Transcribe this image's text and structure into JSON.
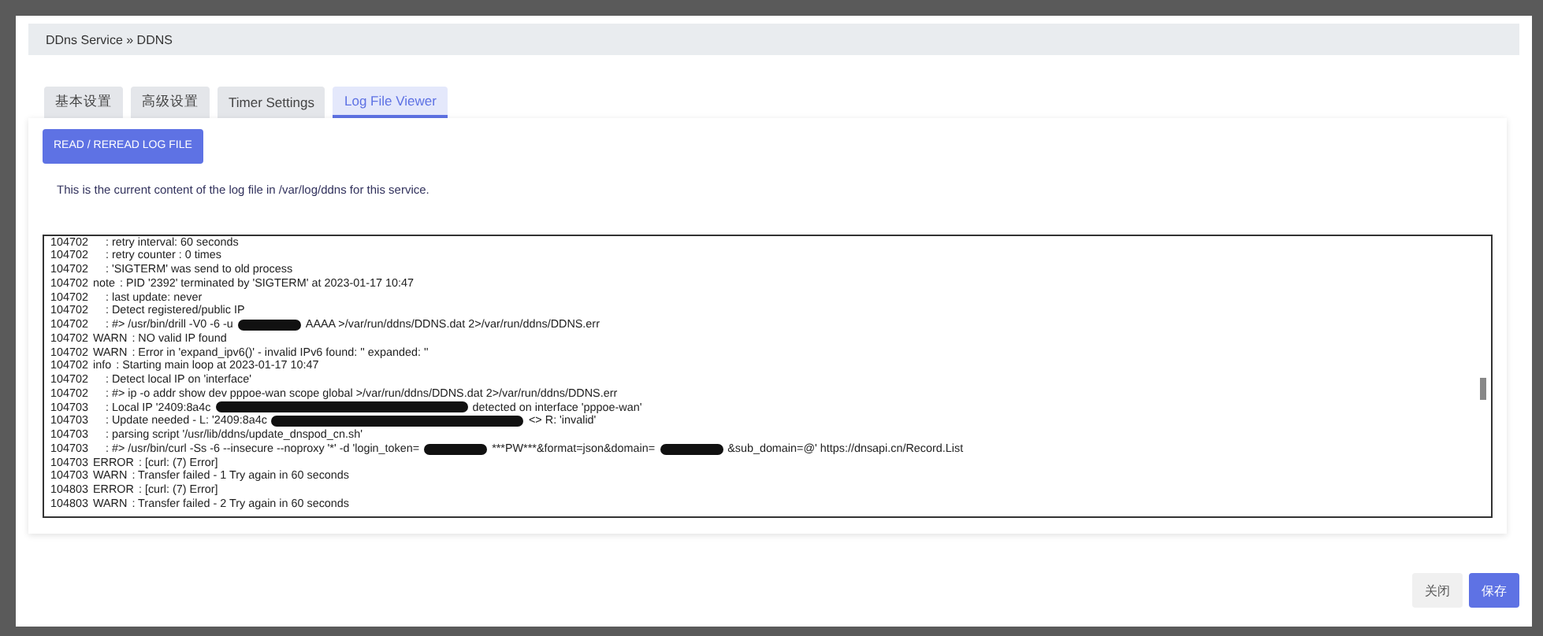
{
  "breadcrumb": "DDns Service » DDNS",
  "tabs": [
    {
      "label": "基本设置",
      "selected": false
    },
    {
      "label": "高级设置",
      "selected": false
    },
    {
      "label": "Timer Settings",
      "selected": false
    },
    {
      "label": "Log File Viewer",
      "selected": true
    }
  ],
  "read_button": "READ / REREAD LOG FILE",
  "description": "This is the current content of the log file in /var/log/ddns for this service.",
  "log_lines": [
    {
      "time": "104702",
      "parts": [
        {
          "kind": "text",
          "text": ": retry interval: 60 seconds"
        }
      ]
    },
    {
      "time": "104702",
      "parts": [
        {
          "kind": "text",
          "text": ": retry counter : 0 times"
        }
      ]
    },
    {
      "time": "104702",
      "parts": [
        {
          "kind": "text",
          "text": ": 'SIGTERM' was send to old process"
        }
      ]
    },
    {
      "time": "104702",
      "level": "note",
      "parts": [
        {
          "kind": "text",
          "text": ": PID '2392' terminated by 'SIGTERM' at 2023-01-17 10:47"
        }
      ]
    },
    {
      "time": "104702",
      "parts": [
        {
          "kind": "text",
          "text": ": last update: never"
        }
      ]
    },
    {
      "time": "104702",
      "parts": [
        {
          "kind": "text",
          "text": ": Detect registered/public IP"
        }
      ]
    },
    {
      "time": "104702",
      "parts": [
        {
          "kind": "text",
          "text": ": #> /usr/bin/drill -V0 -6 -u"
        },
        {
          "kind": "redaction"
        },
        {
          "kind": "text",
          "text": "AAAA >/var/run/ddns/DDNS.dat 2>/var/run/ddns/DDNS.err"
        }
      ]
    },
    {
      "time": "104702",
      "level": "WARN",
      "parts": [
        {
          "kind": "text",
          "text": ": NO valid IP found"
        }
      ]
    },
    {
      "time": "104702",
      "level": "WARN",
      "parts": [
        {
          "kind": "text",
          "text": ": Error in 'expand_ipv6()' - invalid IPv6 found: '' expanded: ''"
        }
      ]
    },
    {
      "time": "104702",
      "level": "info",
      "parts": [
        {
          "kind": "text",
          "text": ": Starting main loop at 2023-01-17 10:47"
        }
      ]
    },
    {
      "time": "104702",
      "parts": [
        {
          "kind": "text",
          "text": ": Detect local IP on 'interface'"
        }
      ]
    },
    {
      "time": "104702",
      "parts": [
        {
          "kind": "text",
          "text": ": #> ip -o addr show dev pppoe-wan scope global >/var/run/ddns/DDNS.dat 2>/var/run/ddns/DDNS.err"
        }
      ]
    },
    {
      "time": "104703",
      "parts": [
        {
          "kind": "text",
          "text": ": Local IP '2409:8a4c"
        },
        {
          "kind": "redaction-long"
        },
        {
          "kind": "text",
          "text": "detected on interface 'pppoe-wan'"
        }
      ]
    },
    {
      "time": "104703",
      "parts": [
        {
          "kind": "text",
          "text": ": Update needed - L: '2409:8a4c"
        },
        {
          "kind": "redaction-long"
        },
        {
          "kind": "text",
          "text": "<> R: 'invalid'"
        }
      ]
    },
    {
      "time": "104703",
      "parts": [
        {
          "kind": "text",
          "text": ": parsing script '/usr/lib/ddns/update_dnspod_cn.sh'"
        }
      ]
    },
    {
      "time": "104703",
      "parts": [
        {
          "kind": "text",
          "text": ": #> /usr/bin/curl -Ss -6 --insecure --noproxy '*' -d 'login_token="
        },
        {
          "kind": "redaction"
        },
        {
          "kind": "text",
          "text": "***PW***&format=json&domain="
        },
        {
          "kind": "redaction"
        },
        {
          "kind": "text",
          "text": "&sub_domain=@' https://dnsapi.cn/Record.List"
        }
      ]
    },
    {
      "time": "104703",
      "level": "ERROR",
      "parts": [
        {
          "kind": "text",
          "text": ": [curl: (7) Error]"
        }
      ]
    },
    {
      "time": "104703",
      "level": "WARN",
      "parts": [
        {
          "kind": "text",
          "text": ": Transfer failed - 1 Try again in 60 seconds"
        }
      ]
    },
    {
      "time": "104803",
      "level": "ERROR",
      "parts": [
        {
          "kind": "text",
          "text": ": [curl: (7) Error]"
        }
      ]
    },
    {
      "time": "104803",
      "level": "WARN",
      "parts": [
        {
          "kind": "text",
          "text": ": Transfer failed - 2 Try again in 60 seconds"
        }
      ]
    }
  ],
  "footer_buttons": [
    {
      "kind": "secondary",
      "label": "关闭"
    },
    {
      "kind": "primary",
      "label": "保存"
    }
  ]
}
